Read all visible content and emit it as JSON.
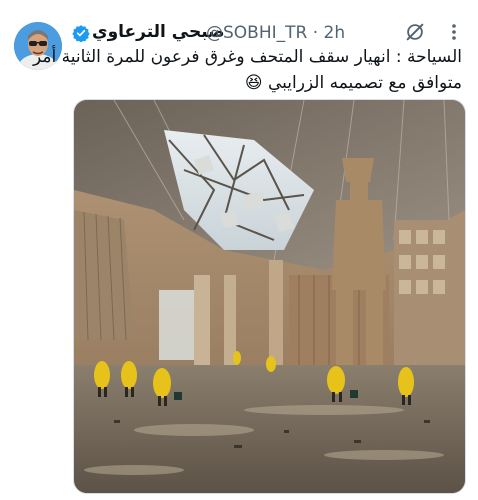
{
  "author": {
    "name": "صبحي الترعاوي",
    "handle": "@SOBHI_TR",
    "separator": "·",
    "time": "2h",
    "verified": true
  },
  "tweet": {
    "text_line1": "السياحة : انهيار سقف المتحف وغرق فرعون للمرة الثانية أمر",
    "text_line2": "متوافق مع تصميمه الزرايبي 😆"
  },
  "icons": {
    "more": "more-icon",
    "grok": "grok-icon",
    "verified": "verified-badge-icon"
  },
  "colors": {
    "verified": "#1d9bf0",
    "secondary_text": "#536471"
  }
}
